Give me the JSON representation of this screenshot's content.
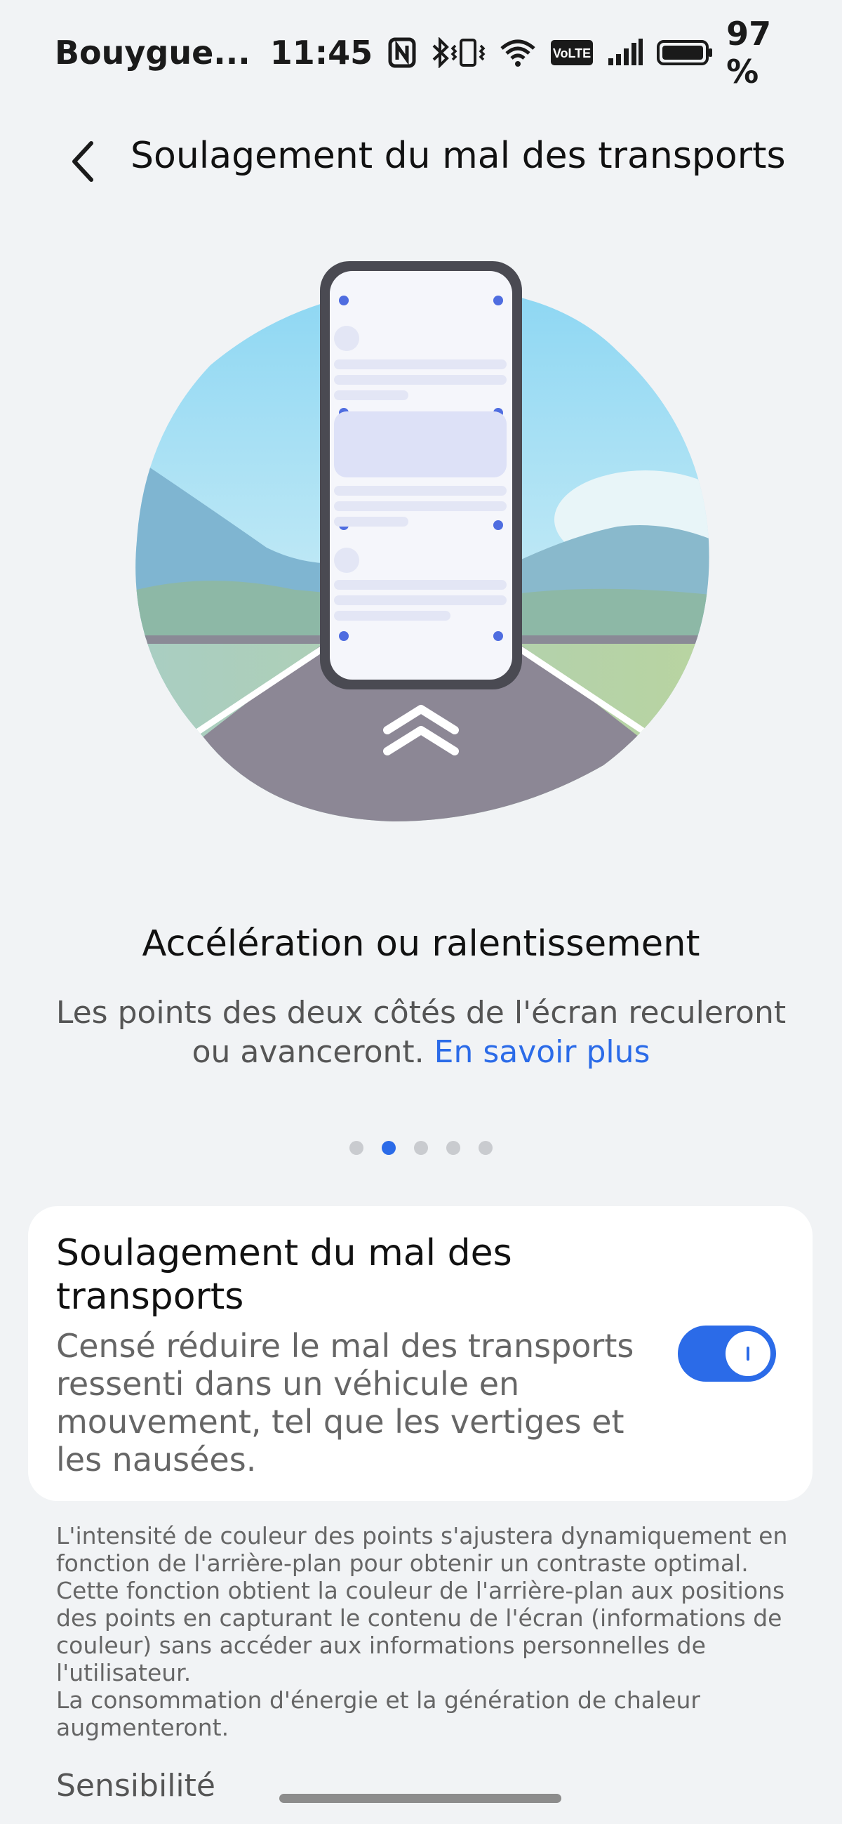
{
  "status_bar": {
    "carrier": "Bouygue...",
    "time": "11:45",
    "battery": "97 %",
    "volte": "VoLTE",
    "icons": [
      "nfc-icon",
      "bluetooth-icon",
      "vibrate-icon",
      "wifi-icon",
      "volte-icon",
      "signal-icon",
      "battery-icon"
    ]
  },
  "header": {
    "title": "Soulagement du mal des transports",
    "back_icon": "back-arrow-icon"
  },
  "slide": {
    "title": "Accélération ou ralentissement",
    "description": "Les points des deux côtés de l'écran reculeront ou avanceront.",
    "link": "En savoir plus",
    "page_count": 5,
    "active_index": 1
  },
  "setting": {
    "title": "Soulagement du mal des transports",
    "description": "Censé réduire le mal des transports ressenti dans un véhicule en mouvement, tel que les vertiges et les nausées.",
    "enabled": true
  },
  "footnote": {
    "line1": "L'intensité de couleur des points s'ajustera dynamiquement en fonction de l'arrière-plan pour obtenir un contraste optimal. Cette fonction obtient la couleur de l'arrière-plan aux positions des points en capturant le contenu de l'écran (informations de couleur) sans accéder aux informations personnelles de l'utilisateur.",
    "line2": "La consommation d'énergie et la génération de chaleur augmenteront."
  },
  "section": {
    "label": "Sensibilité"
  },
  "colors": {
    "accent": "#2b6be8",
    "background": "#f1f3f5",
    "card": "#ffffff"
  }
}
